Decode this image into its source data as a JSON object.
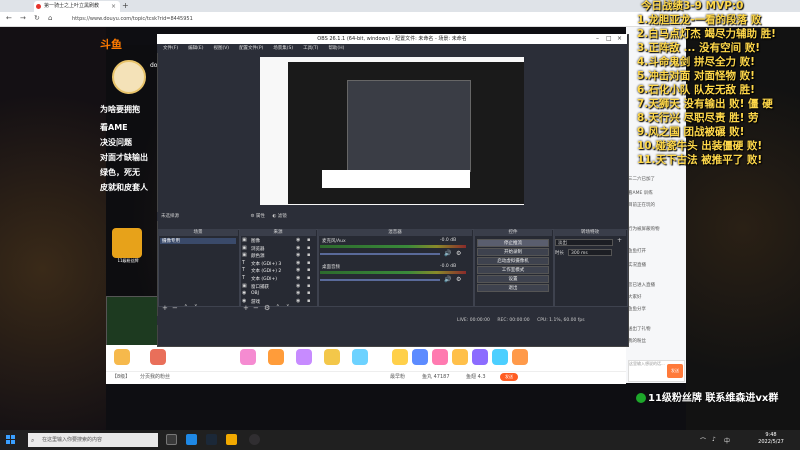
{
  "browser": {
    "tab_title": "第一骑士之上叶立黑刷教",
    "tab_close": "×",
    "new_tab": "+",
    "url": "https://www.douyu.com/topic/tcsk?rid=8445951",
    "back": "←",
    "forward": "→",
    "reload": "↻",
    "home": "⌂"
  },
  "site": {
    "logo": "斗鱼",
    "left_lines": [
      "为啥要拥抱",
      "看AME",
      "决没问题",
      "对面才缺输出",
      "绿色，死无",
      "皮就和皮套人"
    ],
    "streamer_short": "do",
    "badge_label": "11级粉丝牌"
  },
  "overlay": {
    "title": "今日战绩3-9 MVP:0",
    "lines": [
      "1.龙胆亚龙-一看的段落 败",
      "2.白马点灯杰 竭尽力辅助 胜!",
      "3.正阵敌 ... 没有空间 败!",
      "4.斗命鬼剑 拼尽全力 败!",
      "5.冲击对面 对面怪物 败!",
      "6.石化小队 队友无敌 胜!",
      "7.天狮天 没有输出 败! 僵 硬",
      "8.天行兴 尽职尽责 胜! 劳",
      "9.风之国 团战被碾 败!",
      "10.碰瓷牛头 出装僵硬 败!",
      "11.天下古法 被推平了 败!"
    ],
    "fan_badge": "11级粉丝牌",
    "contact": "联系维森进vx群"
  },
  "obs": {
    "title": "OBS 26.1.1 (64-bit, windows) - 配置文件: 未命名 - 场景: 未命名",
    "menu": [
      "文件(F)",
      "编辑(E)",
      "视图(V)",
      "配置文件(P)",
      "场景集(S)",
      "工具(T)",
      "帮助(H)"
    ],
    "scene_bar": "未选择源",
    "scene_bar_props": "属性",
    "scene_bar_filters": "滤镜",
    "docks": {
      "scenes": "场景",
      "sources": "来源",
      "mixer": "混音器",
      "controls": "控件",
      "transitions": "转场特效"
    },
    "scenes": [
      "摄像专用"
    ],
    "sources": [
      {
        "icon": "▣",
        "name": "图像"
      },
      {
        "icon": "▣",
        "name": "浏览器"
      },
      {
        "icon": "▣",
        "name": "颜色源"
      },
      {
        "icon": "T",
        "name": "文本 (GDI+) 3"
      },
      {
        "icon": "T",
        "name": "文本 (GDI+) 2"
      },
      {
        "icon": "T",
        "name": "文本 (GDI+)"
      },
      {
        "icon": "▣",
        "name": "窗口捕获"
      },
      {
        "icon": "◉",
        "name": "OBJ"
      },
      {
        "icon": "◉",
        "name": "游戏"
      }
    ],
    "mixer": [
      {
        "name": "麦克风/Aux",
        "db": "-0.0 dB"
      },
      {
        "name": "桌面音频",
        "db": "-0.0 dB"
      }
    ],
    "controls": [
      "停止推流",
      "开始录制",
      "启动虚拟摄像机",
      "工作室模式",
      "设置",
      "退出"
    ],
    "transition_select": "淡出",
    "duration_label": "时长",
    "duration_value": "300 ms",
    "status": {
      "live": "LIVE: 00:00:00",
      "rec": "REC: 00:00:00",
      "cpu": "CPU: 1.1%, 60.00 fps"
    }
  },
  "page": {
    "bottom_items": [
      "【8级】",
      "分页我的粉丝",
      "发送"
    ],
    "stats": [
      "最早粉",
      "鱼丸 47187",
      "鱼翅 4.3"
    ],
    "chat_lines": [
      "三二六已加了",
      "看AME 训练",
      "目前正在玩的",
      "行为被屏蔽购物",
      "鱼鱼打开",
      "实况直播",
      "您已进入直播",
      "大家好",
      "鱼鱼分享",
      "送出了礼物",
      "我的粉丝"
    ],
    "chat_placeholder": "这里输入想说的话...",
    "chat_send": "发送"
  },
  "taskbar": {
    "search_placeholder": "在这里输入你要搜索的内容",
    "time": "9:48",
    "date": "2022/5/27"
  }
}
